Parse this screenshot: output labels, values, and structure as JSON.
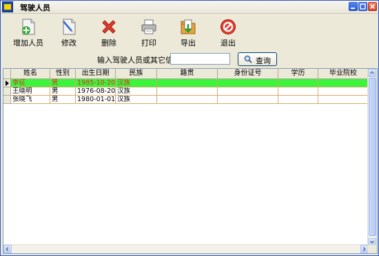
{
  "window": {
    "title": "驾驶人员"
  },
  "toolbar": {
    "add": "增加人员",
    "edit": "修改",
    "delete": "删除",
    "print": "打印",
    "export": "导出",
    "exit": "退出"
  },
  "search": {
    "label": "输入驾驶人员或其它信息：",
    "value": "",
    "button": "查询"
  },
  "grid": {
    "columns": [
      "姓名",
      "性别",
      "出生日期",
      "民族",
      "籍贯",
      "身份证号",
      "学历",
      "毕业院校"
    ],
    "rows": [
      {
        "name": "李征",
        "gender": "男",
        "birth": "1985-10-20",
        "ethnic": "汉族",
        "native": "",
        "id": "",
        "edu": "",
        "school": ""
      },
      {
        "name": "王晓明",
        "gender": "男",
        "birth": "1976-08-20",
        "ethnic": "汉族",
        "native": "",
        "id": "",
        "edu": "",
        "school": ""
      },
      {
        "name": "张晓飞",
        "gender": "男",
        "birth": "1980-01-01",
        "ethnic": "汉族",
        "native": "",
        "id": "",
        "edu": "",
        "school": ""
      }
    ],
    "selected_row": 0
  },
  "colors": {
    "selection": "#3cf43c",
    "selection_text": "#e02e1c",
    "grid_line": "#d7a96a",
    "titlebar_border": "#2a56c6"
  }
}
